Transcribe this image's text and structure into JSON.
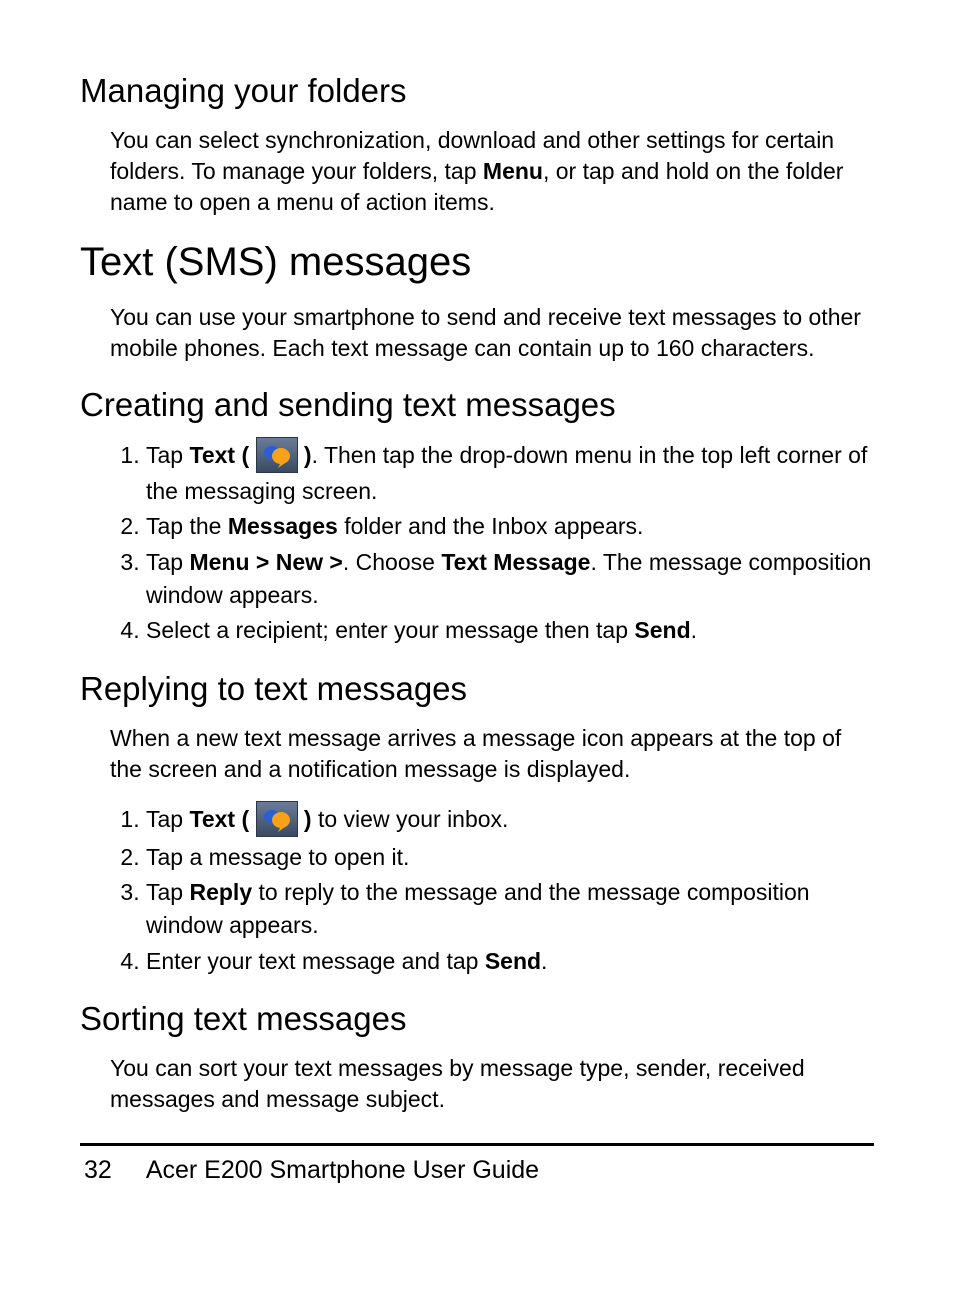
{
  "sec1": {
    "heading": "Managing your folders",
    "p1_a": "You can select synchronization, download and other settings for certain folders. To manage your folders, tap ",
    "p1_bold": "Menu",
    "p1_b": ", or tap and hold on the folder name to open a menu of action items."
  },
  "sec2": {
    "heading": "Text (SMS) messages",
    "p1": "You can use your smartphone to send and receive text messages to other mobile phones. Each text message can contain up to 160 characters."
  },
  "sec3": {
    "heading": "Creating and sending text messages",
    "s1_a": "Tap ",
    "s1_bold1": "Text ( ",
    "s1_bold2": " )",
    "s1_b": ". Then tap the drop-down menu in the top left corner of the messaging screen.",
    "s2_a": "Tap the ",
    "s2_bold": "Messages",
    "s2_b": " folder and the Inbox appears.",
    "s3_a": "Tap ",
    "s3_bold1": "Menu > New >",
    "s3_b": ". Choose ",
    "s3_bold2": "Text Message",
    "s3_c": ". The message composition window appears.",
    "s4_a": "Select a recipient; enter your message then tap ",
    "s4_bold": "Send",
    "s4_b": "."
  },
  "sec4": {
    "heading": "Replying to text messages",
    "p1": "When a new text message arrives a message icon appears at the top of the screen and a notification message is displayed.",
    "s1_a": "Tap ",
    "s1_bold1": "Text ( ",
    "s1_bold2": " )",
    "s1_b": " to view your inbox.",
    "s2": "Tap a message to open it.",
    "s3_a": "Tap ",
    "s3_bold": "Reply",
    "s3_b": " to reply to the message and the message composition window appears.",
    "s4_a": "Enter your text message and tap ",
    "s4_bold": "Send",
    "s4_b": "."
  },
  "sec5": {
    "heading": "Sorting text messages",
    "p1": "You can sort your text messages by message type, sender, received messages and message subject."
  },
  "footer": {
    "page": "32",
    "title": "Acer E200 Smartphone User Guide"
  }
}
